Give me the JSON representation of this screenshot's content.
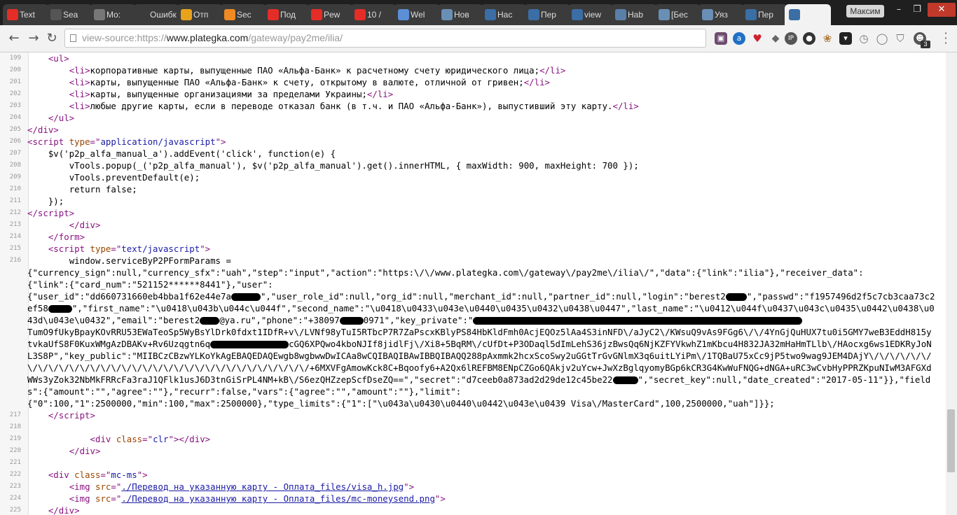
{
  "browser": {
    "tabs": [
      {
        "label": "Text",
        "favicon": "youtube-icon",
        "color": "#e52d27"
      },
      {
        "label": "Sea",
        "favicon": "spotify-icon",
        "color": "#555555"
      },
      {
        "label": "Mo:",
        "favicon": "page-icon",
        "color": "#777777"
      },
      {
        "label": "Ошибка",
        "favicon": "none",
        "color": "#3b3b3b"
      },
      {
        "label": "Отп",
        "favicon": "globe-icon",
        "color": "#e8a21c"
      },
      {
        "label": "Sec",
        "favicon": "fire-icon",
        "color": "#f08a24"
      },
      {
        "label": "Под",
        "favicon": "youtube-icon",
        "color": "#e52d27"
      },
      {
        "label": "Pew",
        "favicon": "youtube-icon",
        "color": "#e52d27"
      },
      {
        "label": "10 /",
        "favicon": "youtube-icon",
        "color": "#e52d27"
      },
      {
        "label": "Wel",
        "favicon": "wordpress-icon",
        "color": "#5b8fd6"
      },
      {
        "label": "Нов",
        "favicon": "n-icon",
        "color": "#6a8fb5"
      },
      {
        "label": "Нас",
        "favicon": "p-icon",
        "color": "#3a6ea5"
      },
      {
        "label": "Пер",
        "favicon": "p-icon",
        "color": "#3a6ea5"
      },
      {
        "label": "view",
        "favicon": "p-icon",
        "color": "#3a6ea5"
      },
      {
        "label": "Hab",
        "favicon": "hs-icon",
        "color": "#5a7fa8"
      },
      {
        "label": "[Бес",
        "favicon": "page-icon",
        "color": "#6a8fb5"
      },
      {
        "label": "Уяз",
        "favicon": "n-icon",
        "color": "#6a8fb5"
      },
      {
        "label": "Пер",
        "favicon": "p-icon",
        "color": "#3a6ea5"
      },
      {
        "label": "",
        "favicon": "p-icon",
        "color": "#3a6ea5",
        "active": true
      }
    ],
    "user_name": "Максим",
    "address": {
      "prefix": "view-source:https://",
      "host": "www.plategka.com",
      "path": "/gateway/pay2me/ilia/"
    },
    "extension_badge": "3"
  },
  "source_lines": [
    {
      "n": "199",
      "html": "    <span class=\"tag\">&lt;ul&gt;</span>"
    },
    {
      "n": "200",
      "html": "        <span class=\"tag\">&lt;li&gt;</span>корпоративные карты, выпущенные ПАО «Альфа-Банк» к расчетному счету юридического лица;<span class=\"tag\">&lt;/li&gt;</span>"
    },
    {
      "n": "201",
      "html": "        <span class=\"tag\">&lt;li&gt;</span>карты, выпущенные ПАО «Альфа-Банк» к счету, открытому в валюте, отличной от гривен;<span class=\"tag\">&lt;/li&gt;</span>"
    },
    {
      "n": "202",
      "html": "        <span class=\"tag\">&lt;li&gt;</span>карты, выпущенные организациями за пределами Украины;<span class=\"tag\">&lt;/li&gt;</span>"
    },
    {
      "n": "203",
      "html": "        <span class=\"tag\">&lt;li&gt;</span>любые другие карты, если в переводе отказал банк (в т.ч. и ПАО «Альфа-Банк»), выпустивший эту карту.<span class=\"tag\">&lt;/li&gt;</span>"
    },
    {
      "n": "204",
      "html": "    <span class=\"tag\">&lt;/ul&gt;</span>"
    },
    {
      "n": "205",
      "html": "<span class=\"tag\">&lt;/div&gt;</span>"
    },
    {
      "n": "206",
      "html": "<span class=\"tag\">&lt;script <span class=\"attr\">type</span>=\"<span class=\"val\">application/javascript</span>\"&gt;</span>"
    },
    {
      "n": "207",
      "html": "    $v('p2p_alfa_manual_a').addEvent('click', function(e) {"
    },
    {
      "n": "208",
      "html": "        vTools.popup(_('p2p_alfa_manual'), $v('p2p_alfa_manual').get().innerHTML, { maxWidth: 900, maxHeight: 700 });"
    },
    {
      "n": "209",
      "html": "        vTools.preventDefault(e);"
    },
    {
      "n": "210",
      "html": "        return false;"
    },
    {
      "n": "211",
      "html": "    });"
    },
    {
      "n": "212",
      "html": "<span class=\"tag\">&lt;/script&gt;</span>"
    },
    {
      "n": "213",
      "html": "        <span class=\"tag\">&lt;/div&gt;</span>"
    },
    {
      "n": "214",
      "html": "    <span class=\"tag\">&lt;/form&gt;</span>"
    },
    {
      "n": "215",
      "html": "    <span class=\"tag\">&lt;script <span class=\"attr\">type</span>=\"<span class=\"val\">text/javascript</span>\"&gt;</span>"
    },
    {
      "n": "216",
      "html": "        window.serviceByP2PFormParams = \n{\"currency_sign\":null,\"currency_sfx\":\"uah\",\"step\":\"input\",\"action\":\"https:\\/\\/www.plategka.com\\/gateway\\/pay2me\\/ilia\\/\",\"data\":{\"link\":\"ilia\"},\"receiver_data\":\n{\"link\":{\"card_num\":\"521152******8441\"},\"user\":\n{\"user_id\":\"dd660731660eb4bba1f62e44e7a<span class=\"redact\" style=\"width:42px\"></span>\",\"user_role_id\":null,\"org_id\":null,\"merchant_id\":null,\"partner_id\":null,\"login\":\"berest2<span class=\"redact\" style=\"width:30px\"></span>\",\"passwd\":\"f1957496d2f5c7cb3caa73c2ef58<span class=\"redact\" style=\"width:34px\"></span>\",\"first_name\":\"\\u0418\\u043b\\u044c\\u044f\",\"second_name\":\"\\u0418\\u0433\\u043e\\u0440\\u0435\\u0432\\u0438\\u0447\",\"last_name\":\"\\u0412\\u044f\\u0437\\u043c\\u0435\\u0442\\u0438\\u043d\\u043e\\u0432\",\"email\":\"berest2<span class=\"redact\" style=\"width:28px\"></span>@ya.ru\",\"phone\":\"+38097<span class=\"redact\" style=\"width:34px\"></span>0971\",\"key_private\":\"<span class=\"redact\" style=\"width:470px\"></span>\nTumO9fUkyBpayKOvRRU53EWaTeoSp5WyBsYlDrk0fdxt1IDfR+v\\/LVNf98yTuI5RTbcP7R7ZaPscxKBlyPS84HbKldFmh0AcjEQOz5lAa4S3inNFD\\/aJyC2\\/KWsuQ9vAs9FGg6\\/\\/4YnGjQuHUX7tu0i5GMY7weB3EddH815ytvkaUfS8F0KuxWMgAzDBAKv+Rv6Uzqgtn6q<span class=\"redact\" style=\"width:112px\"></span>cGQ6XPQwo4kboNJIf8jidlFj\\/Xi8+5BqRM\\/cUfDt+P3ODaql5dImLehS36jzBwsQq6NjKZFYVkwhZ1mKbcu4H832JA32mHaHmTLlb\\/HAocxg6ws1EDKRyJoNL3S8P\",\"key_public\":\"MIIBCzCBzwYLKoYkAgEBAQEDAQEwgb8wgbwwDwICAa8wCQIBAQIBAwIBBQIBAQQ288pAxmmk2hcxScoSwy2uGGtTrGvGNlmX3q6uitLYiPm\\/1TQBaU75xCc9jP5two9wag9JEM4DAjY\\/\\/\\/\\/\\/\\/\\/\\/\\/\\/\\/\\/\\/\\/\\/\\/\\/\\/\\/\\/\\/\\/\\/\\/\\/\\/\\/\\/\\/\\/\\/\\/\\/+6MXVFgAmowKck8C+Bqoofy6+A2Qx6lREFBM8ENpCZGo6QAkjv2uYcw+JwXzBglqyomyBGp6kCR3G4KwWuFNQG+dNGA+uRC3wCvbHyPPRZKpuNIwM3AFGXdWWs3yZok32NbMkFRRcFa3raJ1QFlk1usJ6D3tnGiSrPL4NM+kB\\/S6ezQHZzepScfDseZQ==\",\"secret\":\"d7ceeb0a873ad2d29de12c45be22<span class=\"redact\" style=\"width:36px\"></span>\",\"secret_key\":null,\"date_created\":\"2017-05-11\"}},\"fields\":{\"amount\":\"\",\"agree\":\"\"},\"recurr\":false,\"vars\":{\"agree\":\"\",\"amount\":\"\"},\"limit\":\n{\"0\":100,\"1\":2500000,\"min\":100,\"max\":2500000},\"type_limits\":{\"1\":[\"\\u043a\\u0430\\u0440\\u0442\\u043e\\u0439 Visa\\/MasterCard\",100,2500000,\"uah\"]}};"
    },
    {
      "n": "217",
      "html": "    <span class=\"tag\">&lt;/script&gt;</span>"
    },
    {
      "n": "218",
      "html": ""
    },
    {
      "n": "219",
      "html": "            <span class=\"tag\">&lt;div <span class=\"attr\">class</span>=\"<span class=\"val\">clr</span>\"&gt;&lt;/div&gt;</span>"
    },
    {
      "n": "220",
      "html": "        <span class=\"tag\">&lt;/div&gt;</span>"
    },
    {
      "n": "221",
      "html": ""
    },
    {
      "n": "222",
      "html": "    <span class=\"tag\">&lt;div <span class=\"attr\">class</span>=\"<span class=\"val\">mc-ms</span>\"&gt;</span>"
    },
    {
      "n": "223",
      "html": "        <span class=\"tag\">&lt;img <span class=\"attr\">src</span>=\"<span class=\"lnk\">./Перевод на указанную карту - Оплата_files/visa_h.jpg</span>\"&gt;</span>"
    },
    {
      "n": "224",
      "html": "        <span class=\"tag\">&lt;img <span class=\"attr\">src</span>=\"<span class=\"lnk\">./Перевод на указанную карту - Оплата_files/mc-moneysend.png</span>\"&gt;</span>"
    },
    {
      "n": "225",
      "html": "    <span class=\"tag\">&lt;/div&gt;</span>"
    }
  ]
}
